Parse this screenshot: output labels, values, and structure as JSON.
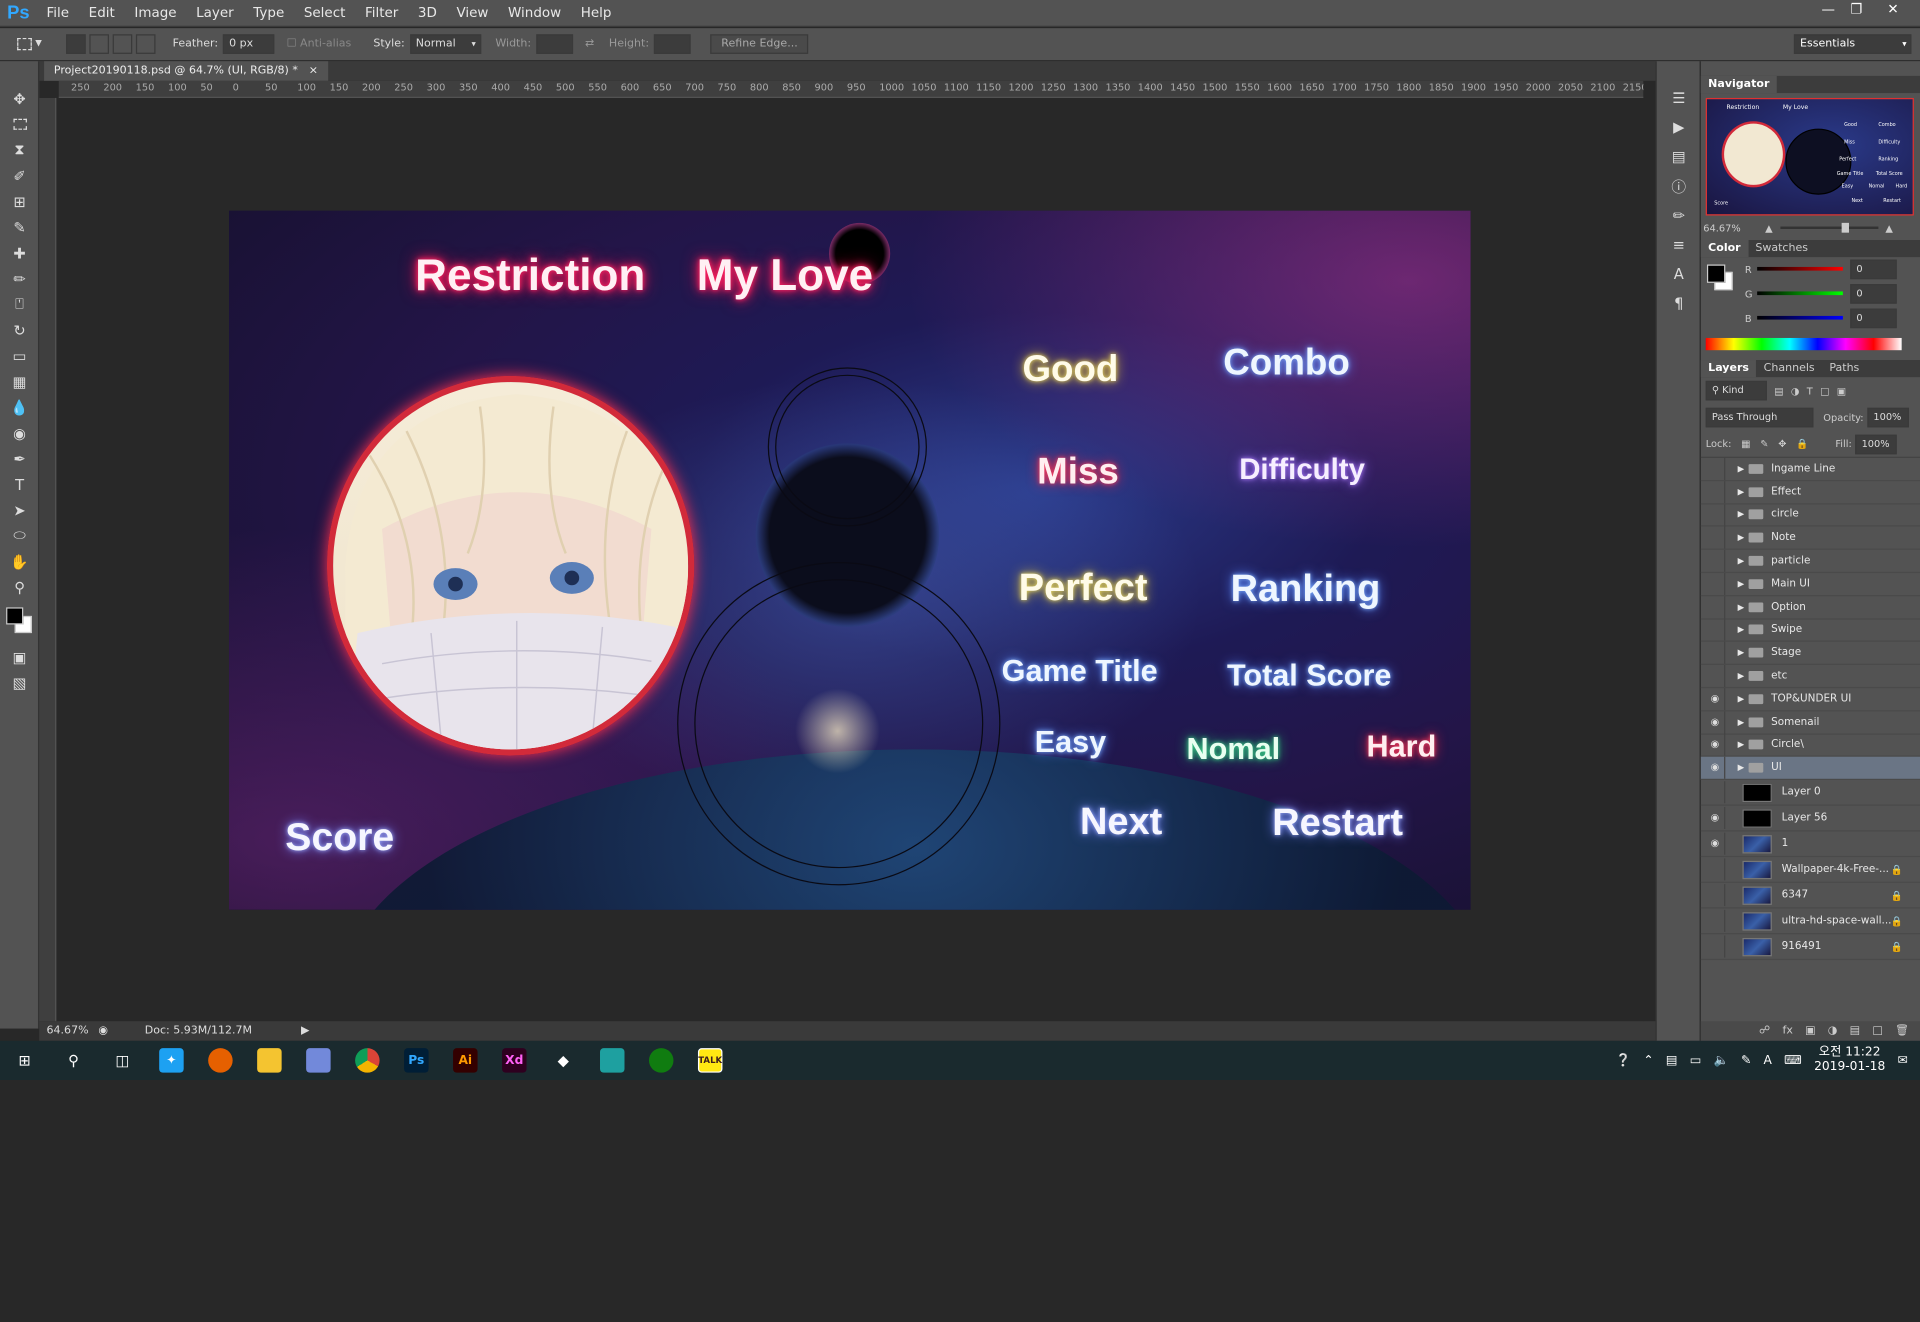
{
  "app": {
    "logo": "Ps",
    "menus": [
      "File",
      "Edit",
      "Image",
      "Layer",
      "Type",
      "Select",
      "Filter",
      "3D",
      "View",
      "Window",
      "Help"
    ],
    "workspace": "Essentials"
  },
  "options": {
    "feather_label": "Feather:",
    "feather_value": "0 px",
    "antialias": "Anti-alias",
    "style_label": "Style:",
    "style_value": "Normal",
    "width_label": "Width:",
    "height_label": "Height:",
    "refine": "Refine Edge..."
  },
  "document": {
    "tab": "Project20190118.psd @ 64.7% (UI, RGB/8) *",
    "close": "×",
    "zoom": "64.67%",
    "doc_info": "Doc: 5.93M/112.7M"
  },
  "ruler": {
    "h": [
      "250",
      "200",
      "150",
      "100",
      "50",
      "0",
      "50",
      "100",
      "150",
      "200",
      "250",
      "300",
      "350",
      "400",
      "450",
      "500",
      "550",
      "600",
      "650",
      "700",
      "750",
      "800",
      "850",
      "900",
      "950",
      "1000",
      "1050",
      "1100",
      "1150",
      "1200",
      "1250",
      "1300",
      "1350",
      "1400",
      "1450",
      "1500",
      "1550",
      "1600",
      "1650",
      "1700",
      "1750",
      "1800",
      "1850",
      "1900",
      "1950",
      "2000",
      "2050",
      "2100",
      "2150"
    ]
  },
  "artboard": {
    "restriction": "Restriction",
    "my_love": "My Love",
    "good": "Good",
    "combo": "Combo",
    "miss": "Miss",
    "difficulty": "Difficulty",
    "perfect": "Perfect",
    "ranking": "Ranking",
    "game_title": "Game Title",
    "total_score": "Total Score",
    "easy": "Easy",
    "nomal": "Nomal",
    "hard": "Hard",
    "score": "Score",
    "next": "Next",
    "restart": "Restart"
  },
  "navigator": {
    "title": "Navigator",
    "zoom": "64.67%",
    "thumb_texts": {
      "restriction": "Restriction",
      "my_love": "My Love",
      "good": "Good",
      "combo": "Combo",
      "miss": "Miss",
      "difficulty": "Difficulty",
      "perfect": "Perfect",
      "ranking": "Ranking",
      "game_title": "Game Title",
      "total_score": "Total Score",
      "easy": "Easy",
      "nomal": "Nomal",
      "hard": "Hard",
      "score": "Score",
      "next": "Next",
      "restart": "Restart"
    }
  },
  "color_panel": {
    "tabs": [
      "Color",
      "Swatches"
    ],
    "r": "0",
    "g": "0",
    "b": "0",
    "r_label": "R",
    "g_label": "G",
    "b_label": "B"
  },
  "layers_panel": {
    "tabs": [
      "Layers",
      "Channels",
      "Paths"
    ],
    "kind": "Kind",
    "blend": "Pass Through",
    "opacity_label": "Opacity:",
    "opacity": "100%",
    "lock_label": "Lock:",
    "fill_label": "Fill:",
    "fill": "100%",
    "layers": [
      {
        "name": "Ingame Line",
        "type": "group",
        "visible": false
      },
      {
        "name": "Effect",
        "type": "group",
        "visible": false
      },
      {
        "name": "circle",
        "type": "group",
        "visible": false
      },
      {
        "name": "Note",
        "type": "group",
        "visible": false
      },
      {
        "name": "particle",
        "type": "group",
        "visible": false
      },
      {
        "name": "Main UI",
        "type": "group",
        "visible": false
      },
      {
        "name": "Option",
        "type": "group",
        "visible": false
      },
      {
        "name": "Swipe",
        "type": "group",
        "visible": false
      },
      {
        "name": "Stage",
        "type": "group",
        "visible": false
      },
      {
        "name": "etc",
        "type": "group",
        "visible": false
      },
      {
        "name": "TOP&UNDER UI",
        "type": "group",
        "visible": true
      },
      {
        "name": "Somenail",
        "type": "group",
        "visible": true
      },
      {
        "name": "Circle\\",
        "type": "group",
        "visible": true
      },
      {
        "name": "UI",
        "type": "group",
        "visible": true,
        "selected": true
      },
      {
        "name": "Layer 0",
        "type": "layer",
        "visible": false
      },
      {
        "name": "Layer 56",
        "type": "layer",
        "visible": true
      },
      {
        "name": "1",
        "type": "image",
        "visible": true
      },
      {
        "name": "Wallpaper-4k-Free-...",
        "type": "image",
        "visible": false,
        "locked": true
      },
      {
        "name": "6347",
        "type": "image",
        "visible": false,
        "locked": true
      },
      {
        "name": "ultra-hd-space-wall...",
        "type": "image",
        "visible": false,
        "locked": true
      },
      {
        "name": "916491",
        "type": "image",
        "visible": false,
        "locked": true
      }
    ]
  },
  "taskbar": {
    "time": "오전 11:22",
    "date": "2019-01-18",
    "ps": "Ps",
    "ai": "Ai",
    "xd": "Xd",
    "talk": "TALK",
    "ime": "A"
  },
  "colors": {
    "accent": "#31a8ff",
    "neon_pink": "#ff2060",
    "selection": "#6a7585"
  }
}
